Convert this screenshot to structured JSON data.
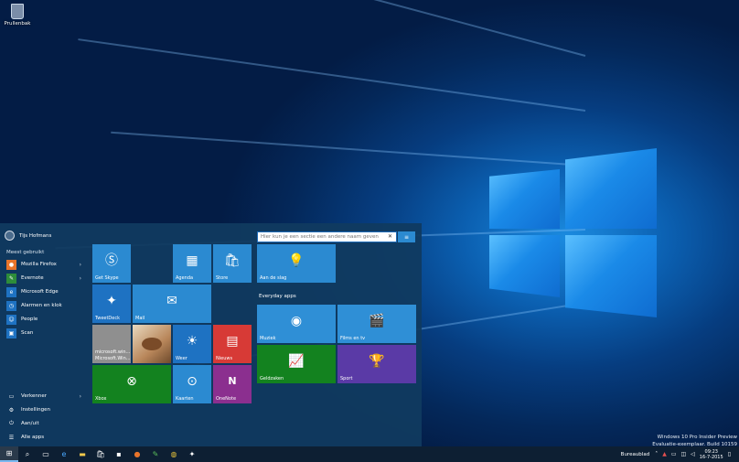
{
  "desktop": {
    "recycle_bin_label": "Prullenbak",
    "watermark_line1": "Windows 10 Pro Insider Preview",
    "watermark_line2": "Evaluatie-exemplaar. Build 10159"
  },
  "start_menu": {
    "user_name": "Tijs Hofmans",
    "most_used_label": "Meest gebruikt",
    "apps": [
      {
        "label": "Mozilla Firefox",
        "icon": "firefox-icon",
        "color": "#e8742a",
        "has_arrow": true
      },
      {
        "label": "Evernote",
        "icon": "evernote-icon",
        "color": "#2d8d3a",
        "has_arrow": true
      },
      {
        "label": "Microsoft Edge",
        "icon": "edge-icon",
        "color": "#1e72c2",
        "has_arrow": false
      },
      {
        "label": "Alarmen en klok",
        "icon": "alarm-icon",
        "color": "#1e72c2",
        "has_arrow": false
      },
      {
        "label": "People",
        "icon": "people-icon",
        "color": "#1e72c2",
        "has_arrow": false
      },
      {
        "label": "Scan",
        "icon": "scan-icon",
        "color": "#1e72c2",
        "has_arrow": false
      }
    ],
    "bottom": {
      "explorer": "Verkenner",
      "settings": "Instellingen",
      "power": "Aan/uit",
      "all_apps": "Alle apps"
    },
    "group_name_placeholder": "Hier kun je een sectie een andere naam geven",
    "group_label": "Everyday apps",
    "tiles": {
      "get_skype": "Get Skype",
      "agenda": "Agenda",
      "store": "Store",
      "tweetdeck": "TweetDeck",
      "mail": "Mail",
      "msn_news": "microsoft.win...",
      "msn_news_sub": "Microsoft.Win...",
      "weather": "Weer",
      "news": "Nieuws",
      "xbox": "Xbox",
      "maps": "Kaarten",
      "onenote": "OneNote",
      "get_started": "Aan de slag",
      "music": "Muziek",
      "movies": "Films en tv",
      "money": "Geldzaken",
      "sport": "Sport"
    }
  },
  "taskbar": {
    "desktop_label": "Bureaublad",
    "time": "09:23",
    "date": "16-7-2015"
  },
  "colors": {
    "accent": "#2b8ad1",
    "start_bg": "#103a60",
    "taskbar_bg": "#0d1f33"
  }
}
